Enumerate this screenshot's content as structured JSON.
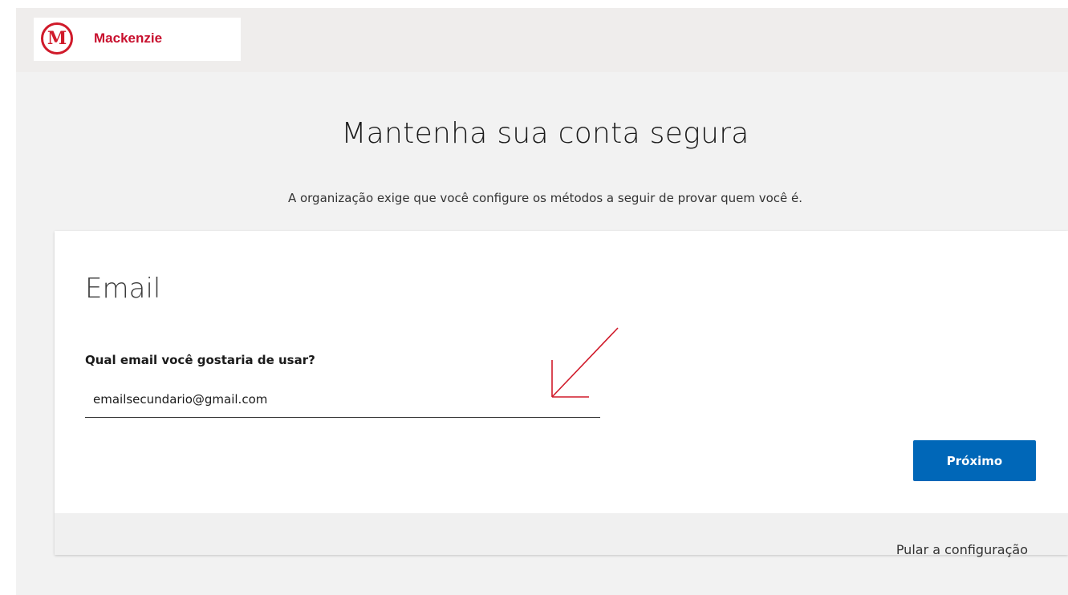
{
  "brand": {
    "logo_letter": "M",
    "name": "Mackenzie",
    "color": "#c8102e"
  },
  "main": {
    "title": "Mantenha sua conta segura",
    "subtitle": "A organização exige que você configure os métodos a seguir de provar quem você é."
  },
  "card": {
    "title": "Email",
    "question": "Qual email você gostaria de usar?",
    "email_value": "emailsecundario@gmail.com",
    "next_label": "Próximo",
    "next_color": "#0067b8"
  },
  "footer": {
    "skip_label": "Pular a configuração"
  },
  "annotation": {
    "icon": "red-arrow-icon",
    "color": "#d01a2a"
  }
}
